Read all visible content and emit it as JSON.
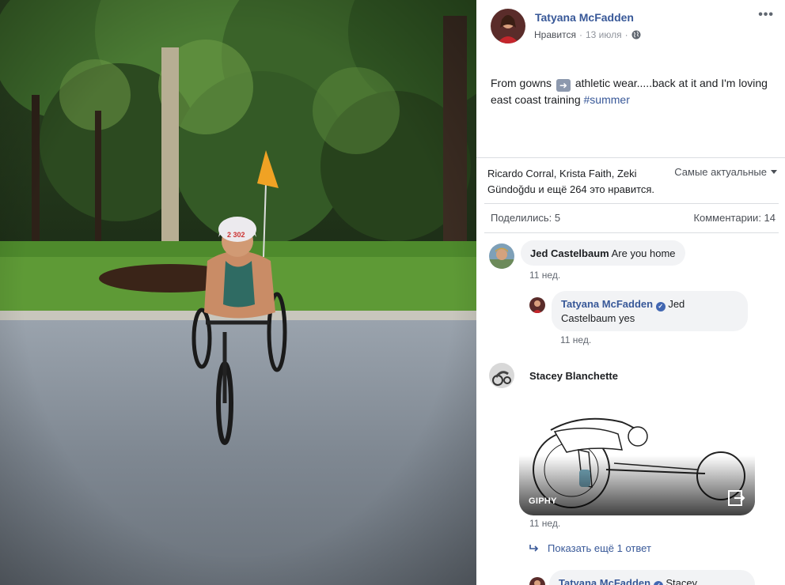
{
  "post": {
    "author": "Tatyana McFadden",
    "like_label": "Нравится",
    "separator": "·",
    "date": "13 июля",
    "privacy_icon": "globe-icon",
    "more_label": "•••",
    "caption_before": "From gowns",
    "caption_emoji": "➡️",
    "caption_after": "athletic wear.....back at it and I'm loving east coast training",
    "hashtag": "#summer"
  },
  "reactions": {
    "likers_text": "Ricardo Corral, Krista Faith, Zeki Gündoğdu и ещё 264 это нравится.",
    "sort_label": "Самые актуальные",
    "shares_label": "Поделились: 5",
    "comments_label": "Комментарии: 14"
  },
  "comments": [
    {
      "author": "Jed Castelbaum",
      "text": "Are you home",
      "time": "11 нед."
    },
    {
      "author": "Tatyana McFadden",
      "text": "Jed Castelbaum yes",
      "time": "11 нед."
    },
    {
      "author": "Stacey Blanchette",
      "gif_label": "GIPHY",
      "time": "11 нед."
    },
    {
      "author": "Tatyana McFadden",
      "text": "Stacey"
    }
  ],
  "show_more_replies": "Показать ещё 1 ответ",
  "colors": {
    "link": "#385898",
    "muted": "#90949c",
    "bubble": "#f2f3f5",
    "divider": "#dadde1",
    "verified": "#4267b2"
  }
}
